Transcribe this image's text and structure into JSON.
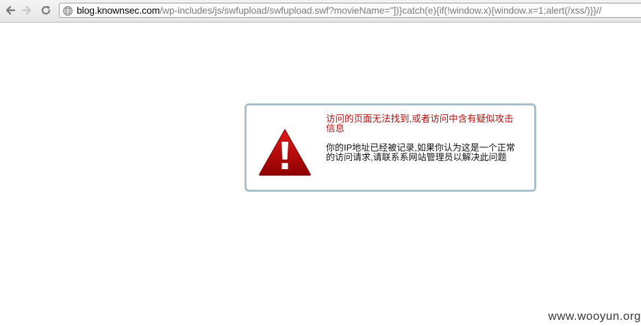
{
  "browser": {
    "back_icon": "arrow-left-icon",
    "forward_icon": "arrow-right-icon",
    "reload_icon": "reload-icon",
    "url_icon": "globe-icon",
    "url_host": "blog.knownsec.com",
    "url_rest": "/wp-includes/js/swfupload/swfupload.swf?movieName=\"])}catch(e){if(!window.x){window.x=1;alert(/xss/)}}//"
  },
  "alert": {
    "icon": "warning-triangle-icon",
    "title": "访问的页面无法找到,或者访问中含有疑似攻击信息",
    "body": "你的IP地址已经被记录,如果你认为这是一个正常的访问请求,请联系系网站管理员以解决此问题",
    "colors": {
      "title": "#b50f0f",
      "border": "#a9c0cc",
      "icon": "#b30000"
    }
  },
  "watermark": "www.wooyun.org"
}
